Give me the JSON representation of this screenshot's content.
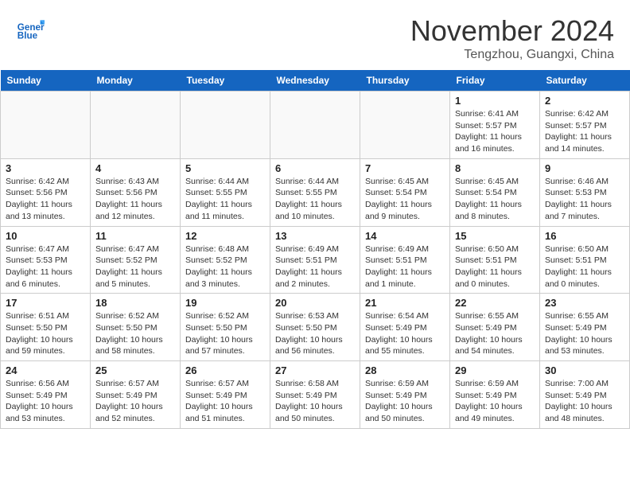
{
  "header": {
    "logo_line1": "General",
    "logo_line2": "Blue",
    "month": "November 2024",
    "location": "Tengzhou, Guangxi, China"
  },
  "weekdays": [
    "Sunday",
    "Monday",
    "Tuesday",
    "Wednesday",
    "Thursday",
    "Friday",
    "Saturday"
  ],
  "weeks": [
    [
      {
        "day": "",
        "info": ""
      },
      {
        "day": "",
        "info": ""
      },
      {
        "day": "",
        "info": ""
      },
      {
        "day": "",
        "info": ""
      },
      {
        "day": "",
        "info": ""
      },
      {
        "day": "1",
        "info": "Sunrise: 6:41 AM\nSunset: 5:57 PM\nDaylight: 11 hours and 16 minutes."
      },
      {
        "day": "2",
        "info": "Sunrise: 6:42 AM\nSunset: 5:57 PM\nDaylight: 11 hours and 14 minutes."
      }
    ],
    [
      {
        "day": "3",
        "info": "Sunrise: 6:42 AM\nSunset: 5:56 PM\nDaylight: 11 hours and 13 minutes."
      },
      {
        "day": "4",
        "info": "Sunrise: 6:43 AM\nSunset: 5:56 PM\nDaylight: 11 hours and 12 minutes."
      },
      {
        "day": "5",
        "info": "Sunrise: 6:44 AM\nSunset: 5:55 PM\nDaylight: 11 hours and 11 minutes."
      },
      {
        "day": "6",
        "info": "Sunrise: 6:44 AM\nSunset: 5:55 PM\nDaylight: 11 hours and 10 minutes."
      },
      {
        "day": "7",
        "info": "Sunrise: 6:45 AM\nSunset: 5:54 PM\nDaylight: 11 hours and 9 minutes."
      },
      {
        "day": "8",
        "info": "Sunrise: 6:45 AM\nSunset: 5:54 PM\nDaylight: 11 hours and 8 minutes."
      },
      {
        "day": "9",
        "info": "Sunrise: 6:46 AM\nSunset: 5:53 PM\nDaylight: 11 hours and 7 minutes."
      }
    ],
    [
      {
        "day": "10",
        "info": "Sunrise: 6:47 AM\nSunset: 5:53 PM\nDaylight: 11 hours and 6 minutes."
      },
      {
        "day": "11",
        "info": "Sunrise: 6:47 AM\nSunset: 5:52 PM\nDaylight: 11 hours and 5 minutes."
      },
      {
        "day": "12",
        "info": "Sunrise: 6:48 AM\nSunset: 5:52 PM\nDaylight: 11 hours and 3 minutes."
      },
      {
        "day": "13",
        "info": "Sunrise: 6:49 AM\nSunset: 5:51 PM\nDaylight: 11 hours and 2 minutes."
      },
      {
        "day": "14",
        "info": "Sunrise: 6:49 AM\nSunset: 5:51 PM\nDaylight: 11 hours and 1 minute."
      },
      {
        "day": "15",
        "info": "Sunrise: 6:50 AM\nSunset: 5:51 PM\nDaylight: 11 hours and 0 minutes."
      },
      {
        "day": "16",
        "info": "Sunrise: 6:50 AM\nSunset: 5:51 PM\nDaylight: 11 hours and 0 minutes."
      }
    ],
    [
      {
        "day": "17",
        "info": "Sunrise: 6:51 AM\nSunset: 5:50 PM\nDaylight: 10 hours and 59 minutes."
      },
      {
        "day": "18",
        "info": "Sunrise: 6:52 AM\nSunset: 5:50 PM\nDaylight: 10 hours and 58 minutes."
      },
      {
        "day": "19",
        "info": "Sunrise: 6:52 AM\nSunset: 5:50 PM\nDaylight: 10 hours and 57 minutes."
      },
      {
        "day": "20",
        "info": "Sunrise: 6:53 AM\nSunset: 5:50 PM\nDaylight: 10 hours and 56 minutes."
      },
      {
        "day": "21",
        "info": "Sunrise: 6:54 AM\nSunset: 5:49 PM\nDaylight: 10 hours and 55 minutes."
      },
      {
        "day": "22",
        "info": "Sunrise: 6:55 AM\nSunset: 5:49 PM\nDaylight: 10 hours and 54 minutes."
      },
      {
        "day": "23",
        "info": "Sunrise: 6:55 AM\nSunset: 5:49 PM\nDaylight: 10 hours and 53 minutes."
      }
    ],
    [
      {
        "day": "24",
        "info": "Sunrise: 6:56 AM\nSunset: 5:49 PM\nDaylight: 10 hours and 53 minutes."
      },
      {
        "day": "25",
        "info": "Sunrise: 6:57 AM\nSunset: 5:49 PM\nDaylight: 10 hours and 52 minutes."
      },
      {
        "day": "26",
        "info": "Sunrise: 6:57 AM\nSunset: 5:49 PM\nDaylight: 10 hours and 51 minutes."
      },
      {
        "day": "27",
        "info": "Sunrise: 6:58 AM\nSunset: 5:49 PM\nDaylight: 10 hours and 50 minutes."
      },
      {
        "day": "28",
        "info": "Sunrise: 6:59 AM\nSunset: 5:49 PM\nDaylight: 10 hours and 50 minutes."
      },
      {
        "day": "29",
        "info": "Sunrise: 6:59 AM\nSunset: 5:49 PM\nDaylight: 10 hours and 49 minutes."
      },
      {
        "day": "30",
        "info": "Sunrise: 7:00 AM\nSunset: 5:49 PM\nDaylight: 10 hours and 48 minutes."
      }
    ]
  ]
}
